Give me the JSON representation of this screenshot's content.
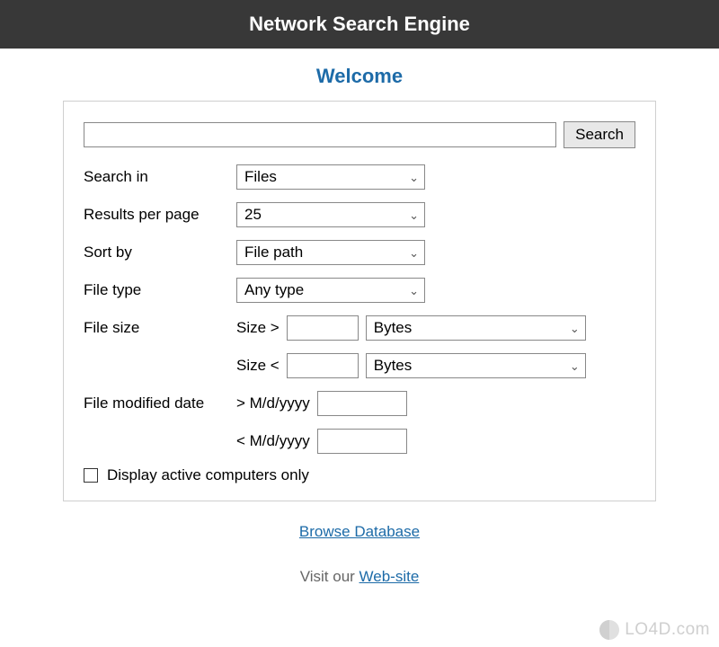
{
  "header": {
    "title": "Network Search Engine"
  },
  "welcome_heading": "Welcome",
  "search": {
    "query_value": "",
    "button_label": "Search"
  },
  "form": {
    "search_in": {
      "label": "Search in",
      "selected": "Files"
    },
    "results_per_page": {
      "label": "Results per page",
      "selected": "25"
    },
    "sort_by": {
      "label": "Sort by",
      "selected": "File path"
    },
    "file_type": {
      "label": "File type",
      "selected": "Any type"
    },
    "file_size": {
      "label": "File size",
      "gt_label": "Size >",
      "gt_unit": "Bytes",
      "lt_label": "Size <",
      "lt_unit": "Bytes"
    },
    "modified_date": {
      "label": "File modified date",
      "gt_label": "> M/d/yyyy",
      "lt_label": "< M/d/yyyy"
    },
    "active_only_label": "Display active computers only"
  },
  "links": {
    "browse_db": "Browse Database",
    "visit_prefix": "Visit our ",
    "website": "Web-site"
  },
  "watermark": "LO4D.com"
}
